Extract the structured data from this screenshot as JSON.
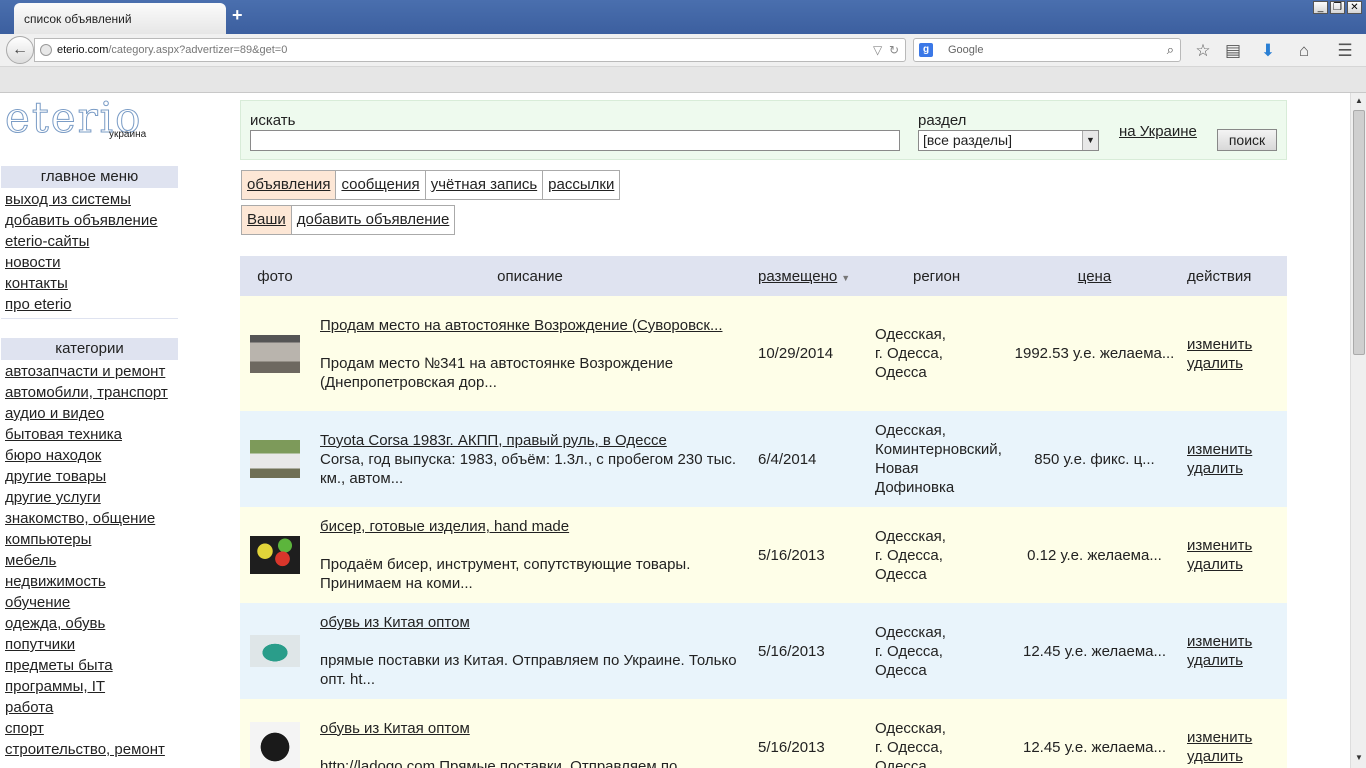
{
  "browser": {
    "tab_title": "список объявлений",
    "new_tab": "+",
    "url_host": "eterio.com",
    "url_path": "/category.aspx?advertizer=89&get=0",
    "search_engine_placeholder": "Google",
    "window_buttons": [
      "_",
      "❐",
      "✕"
    ]
  },
  "logo": {
    "word": "eterio",
    "sub": "украина"
  },
  "main_menu": {
    "title": "главное меню",
    "items": [
      "выход из системы",
      "добавить объявление",
      "eterio-сайты",
      "новости",
      "контакты",
      "про eterio"
    ]
  },
  "categories": {
    "title": "категории",
    "items": [
      "автозапчасти и ремонт",
      "автомобили, транспорт",
      "аудио и видео",
      "бытовая техника",
      "бюро находок",
      "другие товары",
      "другие услуги",
      "знакомство, общение",
      "компьютеры",
      "мебель",
      "недвижимость",
      "обучение",
      "одежда, обувь",
      "попутчики",
      "предметы быта",
      "программы, IT",
      "работа",
      "спорт",
      "строительство, ремонт"
    ]
  },
  "search": {
    "search_label": "искать",
    "section_label": "раздел",
    "section_value": "[все разделы]",
    "ukraine_link": "на Украине",
    "button": "поиск"
  },
  "tabs_primary": [
    "объявления",
    "сообщения",
    "учётная запись",
    "рассылки"
  ],
  "tabs_secondary": [
    "Ваши",
    "добавить объявление"
  ],
  "table": {
    "headers": {
      "photo": "фото",
      "desc": "описание",
      "date": "размещено",
      "region": "регион",
      "price": "цена",
      "actions": "действия"
    },
    "rows": [
      {
        "title": "Продам место на автостоянке Возрождение (Суворовск...",
        "text": "Продам место №341 на автостоянке Возрождение (Днепропетровская дор...",
        "date": "10/29/2014",
        "region": [
          "Одесская,",
          "г. Одесса,",
          "Одесса"
        ],
        "price": "1992.53 у.е. желаема...",
        "edit": "изменить",
        "delete": "удалить",
        "photo": "garage"
      },
      {
        "title": "Toyota Corsa 1983г. АКПП, правый руль, в Одессе",
        "text": "Corsa, год выпуска: 1983, объём: 1.3л., с пробегом 230 тыс. км., автом...",
        "date": "6/4/2014",
        "region": [
          "Одесская,",
          "Коминтерновский,",
          "Новая",
          "Дофиновка"
        ],
        "price": "850 у.е. фикс. ц...",
        "edit": "изменить",
        "delete": "удалить",
        "photo": "car"
      },
      {
        "title": "бисер, готовые изделия, hand made",
        "text": "Продаём бисер, инструмент, сопутствующие товары. Принимаем на коми...",
        "date": "5/16/2013",
        "region": [
          "Одесская,",
          "г. Одесса,",
          "Одесса"
        ],
        "price": "0.12 у.е. желаема...",
        "edit": "изменить",
        "delete": "удалить",
        "photo": "beads"
      },
      {
        "title": "обувь из Китая оптом",
        "text": "прямые поставки из Китая. Отправляем по Украине. Только опт. ht...",
        "date": "5/16/2013",
        "region": [
          "Одесская,",
          "г. Одесса,",
          "Одесса"
        ],
        "price": "12.45 у.е. желаема...",
        "edit": "изменить",
        "delete": "удалить",
        "photo": "shoe-green"
      },
      {
        "title": "обувь из Китая оптом",
        "text": "http://ladogo.com Прямые поставки. Отправляем по",
        "date": "5/16/2013",
        "region": [
          "Одесская,",
          "г. Одесса,",
          "Одесса"
        ],
        "price": "12.45 у.е. желаема...",
        "edit": "изменить",
        "delete": "удалить",
        "photo": "shoe-black"
      }
    ]
  }
}
